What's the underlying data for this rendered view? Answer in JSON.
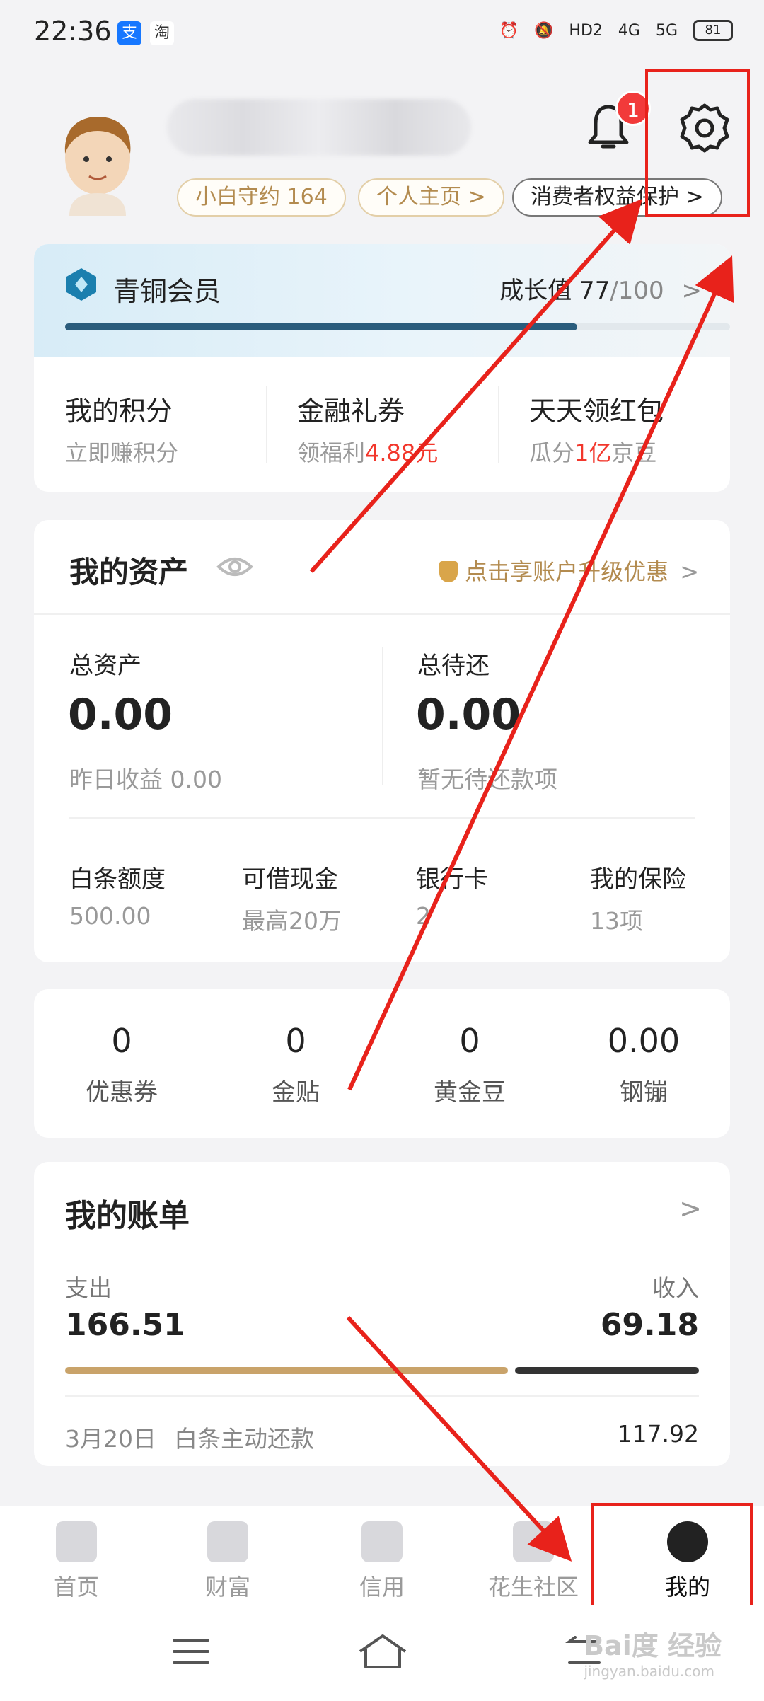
{
  "status_bar": {
    "time": "22:36",
    "app_icons": [
      "支",
      "淘"
    ],
    "network": [
      "HD2",
      "4G",
      "5G"
    ],
    "battery": "81"
  },
  "header": {
    "notification_count": "1",
    "pills": [
      "小白守约 164",
      "个人主页 >",
      "消费者权益保护 >"
    ]
  },
  "member": {
    "level": "青铜会员",
    "growth_label": "成长值 77",
    "growth_max": "/100",
    "chevron": ">",
    "progress": 0.77,
    "cells": [
      {
        "title": "我的积分",
        "sub": "立即赚积分",
        "highlight": ""
      },
      {
        "title": "金融礼券",
        "sub": "领福利",
        "highlight": "4.88元"
      },
      {
        "title": "天天领红包",
        "sub_prefix": "瓜分",
        "highlight": "1亿",
        "sub_suffix": "京豆"
      }
    ]
  },
  "assets": {
    "title": "我的资产",
    "upgrade_text": "点击享账户升级优惠",
    "chevron": ">",
    "total_assets_label": "总资产",
    "total_assets_value": "0.00",
    "yesterday_income": "昨日收益 0.00",
    "total_due_label": "总待还",
    "total_due_value": "0.00",
    "no_due_text": "暂无待还款项",
    "items": [
      {
        "title": "白条额度",
        "sub": "500.00"
      },
      {
        "title": "可借现金",
        "sub": "最高20万"
      },
      {
        "title": "银行卡",
        "sub": "2"
      },
      {
        "title": "我的保险",
        "sub": "13项"
      }
    ]
  },
  "coupons": [
    {
      "value": "0",
      "label": "优惠券"
    },
    {
      "value": "0",
      "label": "金贴"
    },
    {
      "value": "0",
      "label": "黄金豆"
    },
    {
      "value": "0.00",
      "label": "钢镚"
    }
  ],
  "bill": {
    "title": "我的账单",
    "chevron": ">",
    "expense_label": "支出",
    "expense_value": "166.51",
    "income_label": "收入",
    "income_value": "69.18",
    "footer_date": "3月20日",
    "footer_text": "白条主动还款",
    "footer_amount": "117.92"
  },
  "tabs": [
    {
      "label": "首页"
    },
    {
      "label": "财富"
    },
    {
      "label": "信用"
    },
    {
      "label": "花生社区"
    },
    {
      "label": "我的"
    }
  ],
  "watermark": {
    "text": "Bai度 经验",
    "sub": "jingyan.baidu.com"
  },
  "colors": {
    "accent_red": "#e8221b",
    "gold": "#b38b4f",
    "member_blue": "#2a5c7c"
  }
}
